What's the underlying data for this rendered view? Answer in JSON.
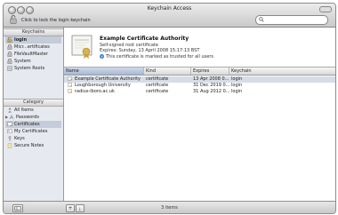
{
  "window": {
    "title": "Keychain Access",
    "lock_text": "Click to lock the login keychain",
    "search": {
      "placeholder": "",
      "value": ""
    }
  },
  "sidebar": {
    "keychains_header": "Keychains",
    "keychains": [
      {
        "label": "login",
        "icon": "lock-open-icon",
        "selected": true
      },
      {
        "label": "Micr...ertificates",
        "icon": "lock-icon",
        "selected": false
      },
      {
        "label": "FileVaultMaster",
        "icon": "lock-icon",
        "selected": false
      },
      {
        "label": "System",
        "icon": "lock-icon",
        "selected": false
      },
      {
        "label": "System Roots",
        "icon": "cabinet-icon",
        "selected": false
      }
    ],
    "category_header": "Category",
    "categories": [
      {
        "label": "All Items",
        "icon": "all-items-icon",
        "selected": false
      },
      {
        "label": "Passwords",
        "icon": "passwords-icon",
        "selected": false
      },
      {
        "label": "Certificates",
        "icon": "certificates-icon",
        "selected": true
      },
      {
        "label": "My Certificates",
        "icon": "my-certificates-icon",
        "selected": false
      },
      {
        "label": "Keys",
        "icon": "key-icon",
        "selected": false
      },
      {
        "label": "Secure Notes",
        "icon": "note-icon",
        "selected": false
      }
    ]
  },
  "detail": {
    "title": "Example Certificate Authority",
    "subtitle": "Self-signed root certificate",
    "expires": "Expires: Sunday, 13 April 2008 15:17:13 BST",
    "trust": "This certificate is marked as trusted for all users"
  },
  "table": {
    "columns": [
      "Name",
      "Kind",
      "Expires",
      "Keychain"
    ],
    "rows": [
      {
        "name": "Example Certificate Authority",
        "kind": "certificate",
        "expires": "13 Apr 2008 0...",
        "keychain": "login",
        "selected": true
      },
      {
        "name": "Loughborough University",
        "kind": "certificate",
        "expires": "31 Dec 2019 0...",
        "keychain": "login",
        "selected": false
      },
      {
        "name": "radius-lboro.ac.uk",
        "kind": "certificate",
        "expires": "31 Aug 2012 0...",
        "keychain": "login",
        "selected": false
      }
    ]
  },
  "status": {
    "count": "3 items"
  },
  "colors": {
    "selection": "#c4ccd9",
    "sidebar_bg": "#e6eaf0",
    "trust_blue": "#3a7ee0"
  }
}
